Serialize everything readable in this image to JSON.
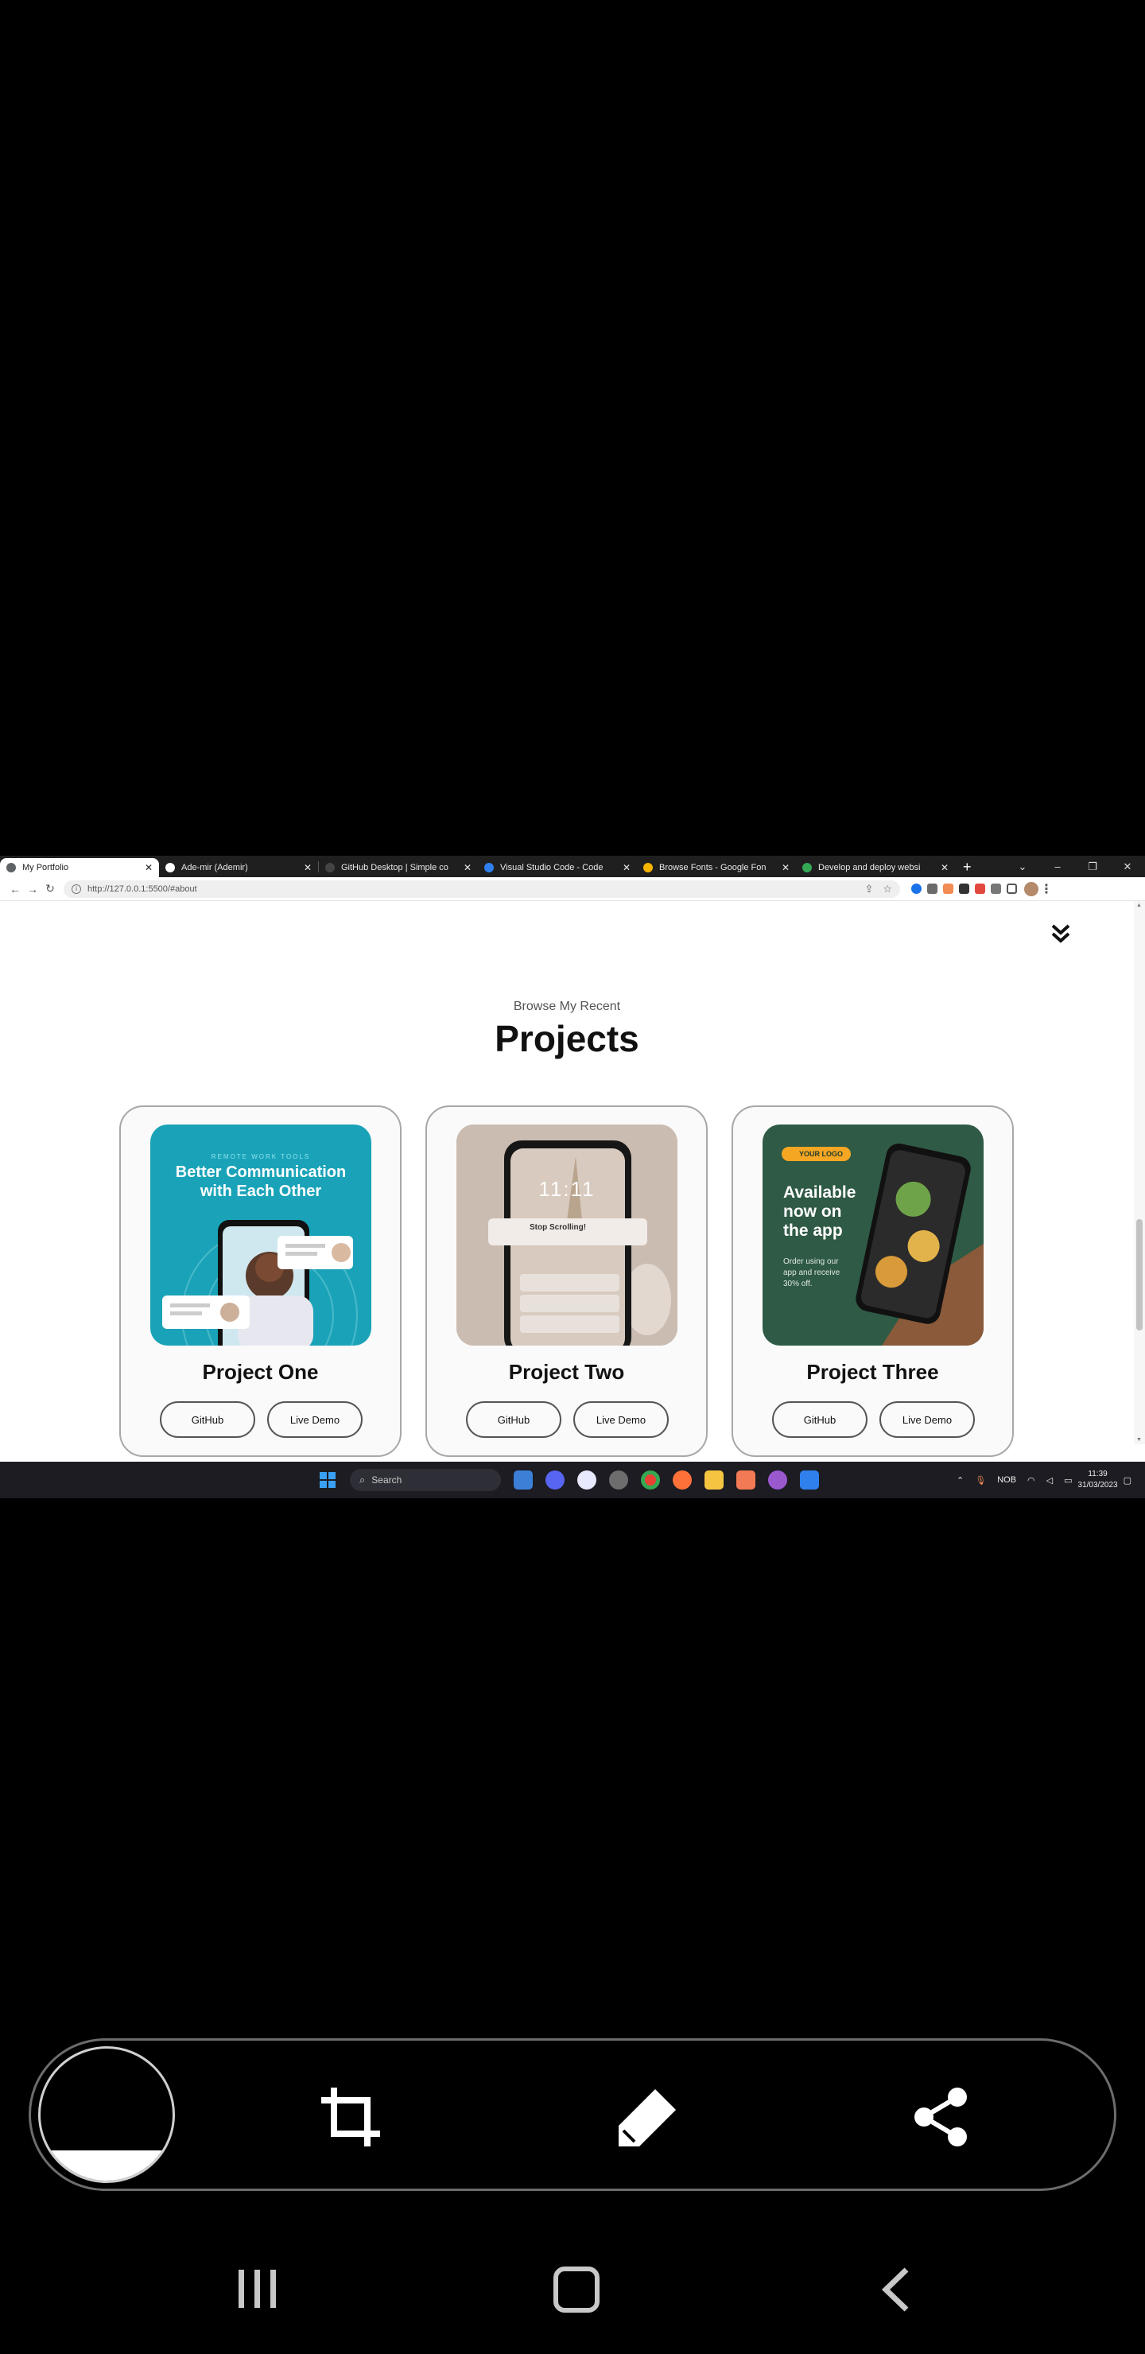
{
  "browser": {
    "tabs": [
      {
        "label": "My Portfolio",
        "active": true,
        "favicon_color": "#5f6368"
      },
      {
        "label": "Ade-mir (Ademir)",
        "active": false,
        "favicon_color": "#ffffff"
      },
      {
        "label": "GitHub Desktop | Simple co",
        "active": false,
        "favicon_color": "#444444"
      },
      {
        "label": "Visual Studio Code - Code",
        "active": false,
        "favicon_color": "#2f80ed"
      },
      {
        "label": "Browse Fonts - Google Fon",
        "active": false,
        "favicon_color": "#f4b400"
      },
      {
        "label": "Develop and deploy websi",
        "active": false,
        "favicon_color": "#34a853"
      }
    ],
    "new_tab_label": "+",
    "url": "http://127.0.0.1:5500/#about"
  },
  "page": {
    "subtitle": "Browse My Recent",
    "title": "Projects",
    "projects": [
      {
        "title": "Project One",
        "github_label": "GitHub",
        "demo_label": "Live Demo",
        "image_text_small": "REMOTE WORK TOOLS",
        "image_text_main": "Better Communication with Each Other",
        "image_bg": "#1aa3b8"
      },
      {
        "title": "Project Two",
        "github_label": "GitHub",
        "demo_label": "Live Demo",
        "image_time": "11:11",
        "image_notice": "Stop Scrolling!",
        "image_bg": "#c9b8ad"
      },
      {
        "title": "Project Three",
        "github_label": "GitHub",
        "demo_label": "Live Demo",
        "image_badge": "YOUR LOGO",
        "image_heading": "Available now on the app",
        "image_body": "Order using our app and receive 30% off.",
        "image_bg": "#2f5a45"
      }
    ]
  },
  "taskbar": {
    "search_placeholder": "Search",
    "language": "NOB",
    "time": "11:39",
    "date": "31/03/2023"
  },
  "colors": {
    "accent_orange": "#f5a623",
    "card_border": "#a8a8a8"
  }
}
